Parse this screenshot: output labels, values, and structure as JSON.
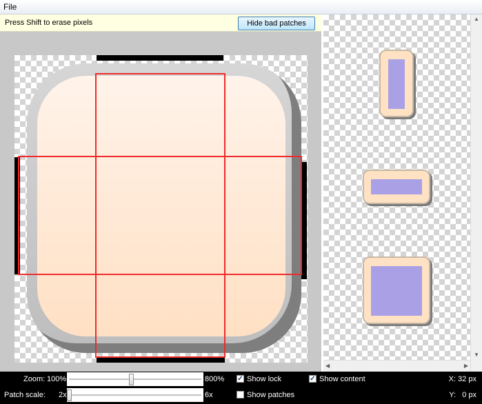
{
  "menubar": {
    "file_label": "File"
  },
  "infobar": {
    "text": "Press Shift to erase pixels",
    "hide_patches_button": "Hide bad patches"
  },
  "preview_panel": {
    "content_color": "#a9a0e6",
    "button_color": "#ffe2c4"
  },
  "canvas": {
    "patch_line_color": "#ee2a2a",
    "marker_color": "#000000"
  },
  "status": {
    "zoom_label": "Zoom:",
    "zoom_min": "100%",
    "zoom_max": "800%",
    "zoom_value_fraction": 0.47,
    "patch_scale_label": "Patch scale:",
    "patch_min": "2x",
    "patch_max": "6x",
    "patch_value_fraction": 0.0,
    "show_lock": {
      "label": "Show lock",
      "checked": true
    },
    "show_content": {
      "label": "Show content",
      "checked": true
    },
    "show_patches": {
      "label": "Show patches",
      "checked": false
    },
    "x_readout": "X: 32 px",
    "y_readout": "Y:   0 px"
  }
}
